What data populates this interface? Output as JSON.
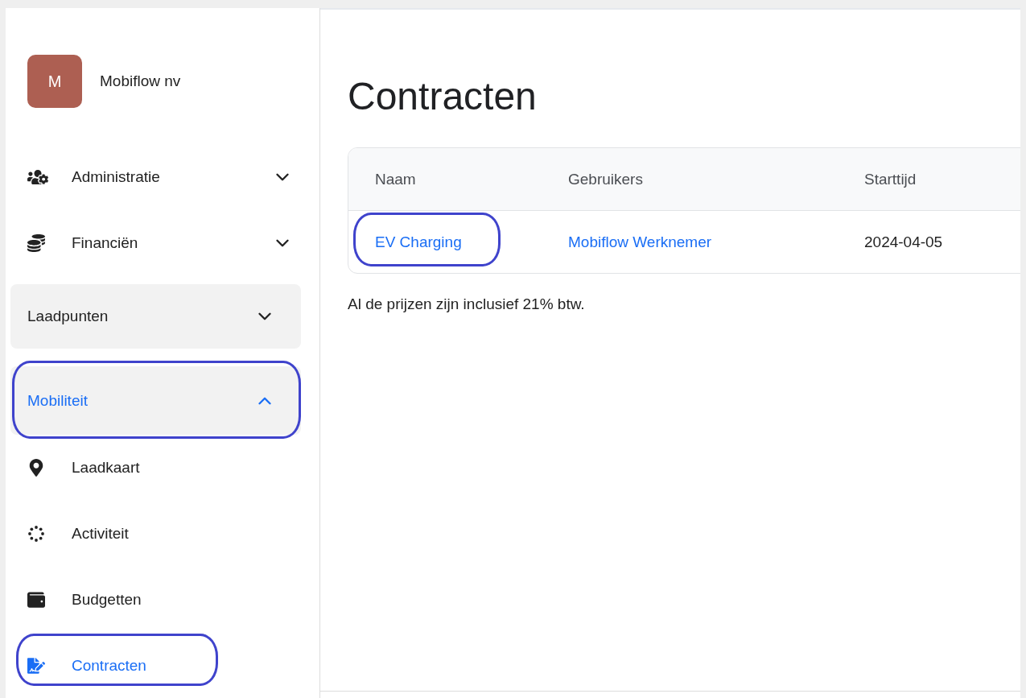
{
  "organization": {
    "initial": "M",
    "name": "Mobiflow nv"
  },
  "sidebar": {
    "items": [
      {
        "kind": "section",
        "label": "Administratie",
        "expanded": false
      },
      {
        "kind": "section",
        "label": "Financiën",
        "expanded": false
      },
      {
        "kind": "group",
        "label": "Laadpunten",
        "expanded": false,
        "highlighted": false
      },
      {
        "kind": "group",
        "label": "Mobiliteit",
        "expanded": true,
        "highlighted": true,
        "children": [
          {
            "label": "Laadkaart",
            "selected": false,
            "highlighted": false
          },
          {
            "label": "Activiteit",
            "selected": false,
            "highlighted": false
          },
          {
            "label": "Budgetten",
            "selected": false,
            "highlighted": false
          },
          {
            "label": "Contracten",
            "selected": true,
            "highlighted": true
          }
        ]
      }
    ]
  },
  "page": {
    "title": "Contracten"
  },
  "table": {
    "columns": [
      "Naam",
      "Gebruikers",
      "Starttijd"
    ],
    "rows": [
      {
        "cells": [
          {
            "text": "EV Charging",
            "kind": "link",
            "highlighted": true
          },
          {
            "text": "Mobiflow Werknemer",
            "kind": "link",
            "highlighted": false
          },
          {
            "text": "2024-04-05",
            "kind": "text",
            "highlighted": false
          }
        ]
      }
    ]
  },
  "note": "Al de prijzen zijn inclusief 21% btw."
}
